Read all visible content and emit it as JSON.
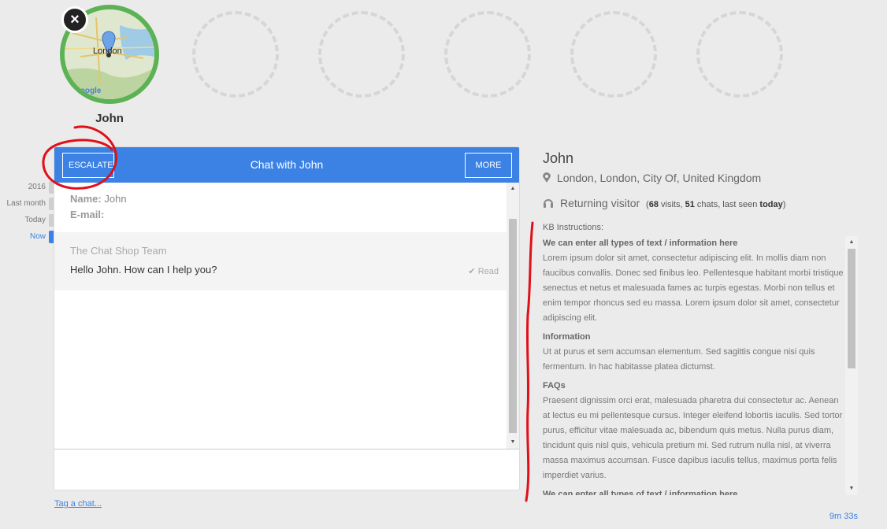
{
  "visitor": {
    "name": "John",
    "close_glyph": "×",
    "map_label": "London",
    "map_logo": "Google"
  },
  "timeline": [
    {
      "label": "2016",
      "active": false
    },
    {
      "label": "Last month",
      "active": false
    },
    {
      "label": "Today",
      "active": false
    },
    {
      "label": "Now",
      "active": true
    }
  ],
  "chat": {
    "title": "Chat with John",
    "escalate_label": "ESCALATE",
    "more_label": "MORE",
    "info": {
      "name_label": "Name:",
      "name_value": "John",
      "email_label": "E-mail:",
      "email_value": ""
    },
    "message": {
      "author": "The Chat Shop Team",
      "text": "Hello John. How can I help you?",
      "status": "Read"
    },
    "tag_link": "Tag a chat..."
  },
  "details": {
    "name": "John",
    "location": "London, London, City Of, United Kingdom",
    "visitor_type": "Returning visitor",
    "stats_open": "(",
    "visits": "68",
    "visits_label": "visits,",
    "chats": "51",
    "chats_label": "chats, last seen",
    "last_seen": "today",
    "stats_close": ")",
    "kb_title": "KB Instructions:",
    "kb_sections": [
      {
        "heading": "We can enter all types of text / information here",
        "body": "Lorem ipsum dolor sit amet, consectetur adipiscing elit. In mollis diam non faucibus convallis. Donec sed finibus leo. Pellentesque habitant morbi tristique senectus et netus et malesuada fames ac turpis egestas. Morbi non tellus et enim tempor rhoncus sed eu massa. Lorem ipsum dolor sit amet, consectetur adipiscing elit."
      },
      {
        "heading": "Information",
        "body": "Ut at purus et sem accumsan elementum. Sed sagittis congue nisi quis fermentum. In hac habitasse platea dictumst."
      },
      {
        "heading": "FAQs",
        "body": "Praesent dignissim orci erat, malesuada pharetra dui consectetur ac. Aenean at lectus eu mi pellentesque cursus. Integer eleifend lobortis iaculis. Sed tortor purus, efficitur vitae malesuada ac, bibendum quis metus. Nulla purus diam, tincidunt quis nisl quis, vehicula pretium mi. Sed rutrum nulla nisl, at viverra massa maximus accumsan. Fusce dapibus iaculis tellus, maximus porta felis imperdiet varius."
      },
      {
        "heading": "We can enter all types of text / information here",
        "body": ""
      }
    ]
  },
  "timer": "9m 33s",
  "colors": {
    "accent": "#3b82e4",
    "active_ring": "#5db256",
    "annotation": "#e0101a"
  }
}
